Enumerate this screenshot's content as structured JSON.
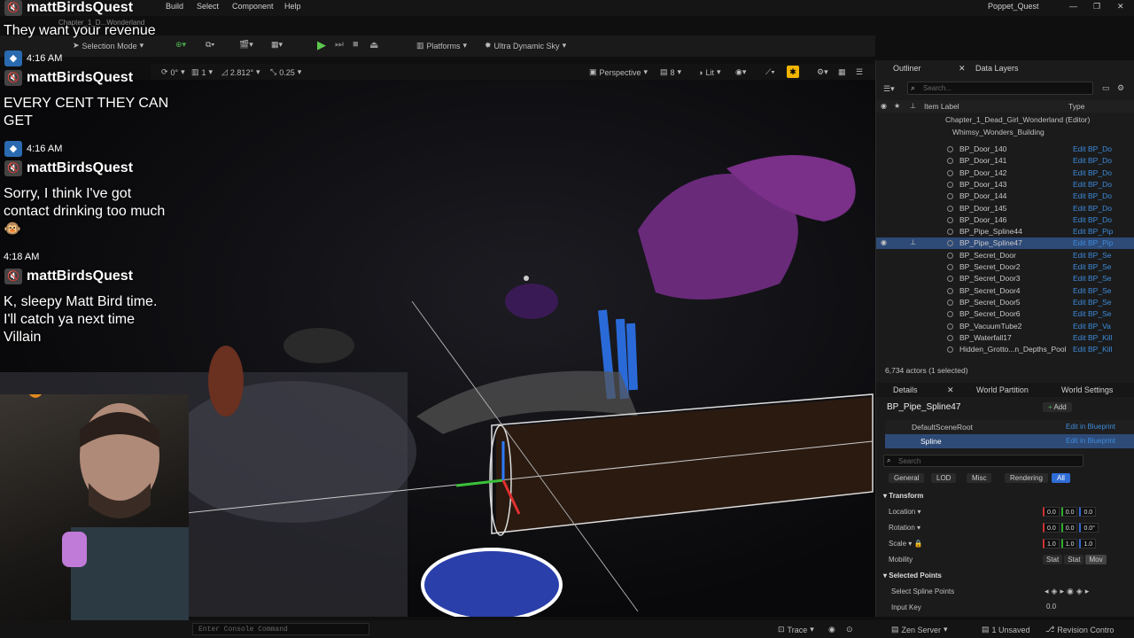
{
  "menu": {
    "items": [
      "Build",
      "Select",
      "Component",
      "Help"
    ],
    "project": "Poppet_Quest",
    "map_tab": "Chapter_1_D...Wonderland"
  },
  "toolbar": {
    "mode": "Selection Mode",
    "platforms": "Platforms",
    "sky": "Ultra Dynamic Sky"
  },
  "viewport_bar": {
    "v1": "0°",
    "v2": "1",
    "v3": "2.812°",
    "v4": "0.25",
    "perspective": "Perspective",
    "n": "8",
    "lit": "Lit"
  },
  "outliner": {
    "tab": "Outliner",
    "tab2": "Data Layers",
    "search_placeholder": "Search...",
    "col_label": "Item Label",
    "col_type": "Type",
    "root": "Chapter_1_Dead_Girl_Wonderland (Editor)",
    "folder": "Whimsy_Wonders_Building",
    "rows": [
      {
        "label": "BP_Door_140",
        "type": "Edit BP_Do"
      },
      {
        "label": "BP_Door_141",
        "type": "Edit BP_Do"
      },
      {
        "label": "BP_Door_142",
        "type": "Edit BP_Do"
      },
      {
        "label": "BP_Door_143",
        "type": "Edit BP_Do"
      },
      {
        "label": "BP_Door_144",
        "type": "Edit BP_Do"
      },
      {
        "label": "BP_Door_145",
        "type": "Edit BP_Do"
      },
      {
        "label": "BP_Door_146",
        "type": "Edit BP_Do"
      },
      {
        "label": "BP_Pipe_Spline44",
        "type": "Edit BP_Pip"
      },
      {
        "label": "BP_Pipe_Spline47",
        "type": "Edit BP_Pip"
      },
      {
        "label": "BP_Secret_Door",
        "type": "Edit BP_Se"
      },
      {
        "label": "BP_Secret_Door2",
        "type": "Edit BP_Se"
      },
      {
        "label": "BP_Secret_Door3",
        "type": "Edit BP_Se"
      },
      {
        "label": "BP_Secret_Door4",
        "type": "Edit BP_Se"
      },
      {
        "label": "BP_Secret_Door5",
        "type": "Edit BP_Se"
      },
      {
        "label": "BP_Secret_Door6",
        "type": "Edit BP_Se"
      },
      {
        "label": "BP_VacuumTube2",
        "type": "Edit BP_Va"
      },
      {
        "label": "BP_Waterfall17",
        "type": "Edit BP_Kill"
      },
      {
        "label": "Hidden_Grotto...n_Depths_Pool",
        "type": "Edit BP_Kill"
      }
    ],
    "status": "6,734 actors (1 selected)"
  },
  "details": {
    "tab": "Details",
    "tab2": "World Partition",
    "tab3": "World Settings",
    "actor": "BP_Pipe_Spline47",
    "add": "Add",
    "comp1": "DefaultSceneRoot",
    "comp2": "Spline",
    "edit_bp": "Edit in Blueprint",
    "search_placeholder": "Search",
    "filters": [
      "General",
      "LOD",
      "Misc",
      "Rendering",
      "All"
    ],
    "transform": "Transform",
    "location": "Location",
    "rotation": "Rotation",
    "scale": "Scale",
    "mobility": "Mobility",
    "loc": [
      "0.0",
      "0.0",
      "0.0"
    ],
    "rot": [
      "0.0",
      "0.0",
      "0.0°"
    ],
    "scl": [
      "1.0",
      "1.0",
      "1.0"
    ],
    "mob": [
      "Stat",
      "Stat",
      "Mov"
    ],
    "selected_points": "Selected Points",
    "select_spline": "Select Spline Points",
    "input_key": "Input Key",
    "input_val": "0.0"
  },
  "chat": {
    "name": "mattBirdsQuest",
    "msg0": "They want your revenue",
    "t1": "4:16 AM",
    "msg1": "EVERY CENT THEY CAN GET",
    "t2": "4:16 AM",
    "msg2": "Sorry, I think I've got contact drinking too much 🐵",
    "t3": "4:18 AM",
    "msg3": "K, sleepy Matt Bird time. I'll catch ya next time Villain"
  },
  "status": {
    "console": "Enter Console Command",
    "trace": "Trace",
    "server": "Zen Server",
    "unsaved": "1 Unsaved",
    "revision": "Revision Contro"
  }
}
